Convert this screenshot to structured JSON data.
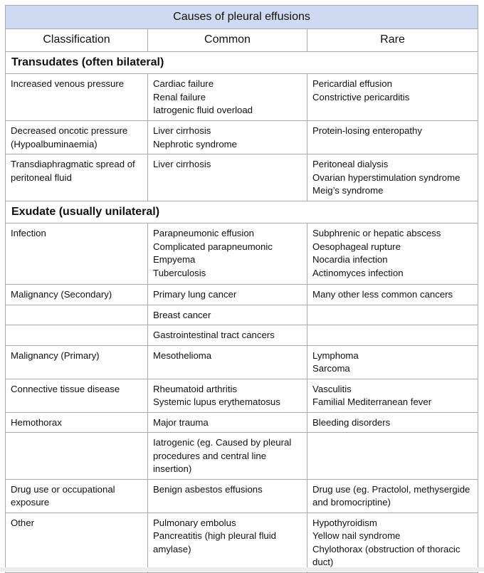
{
  "table": {
    "title": "Causes of pleural effusions",
    "columns": [
      "Classification",
      "Common",
      "Rare"
    ],
    "colors": {
      "title_background": "#cfdaf0",
      "border": "#a9a9a9"
    },
    "sections": [
      {
        "heading": "Transudates (often bilateral)",
        "rows": [
          {
            "classification": "Increased venous pressure",
            "common": [
              "Cardiac failure",
              "Renal failure",
              "Iatrogenic fluid overload"
            ],
            "rare": [
              "Pericardial effusion",
              "Constrictive pericarditis"
            ]
          },
          {
            "classification": "Decreased oncotic pressure (Hypoalbuminaemia)",
            "common": [
              "Liver cirrhosis",
              "Nephrotic syndrome"
            ],
            "rare": [
              "Protein-losing enteropathy"
            ]
          },
          {
            "classification": "Transdiaphragmatic spread of peritoneal fluid",
            "common": [
              "Liver cirrhosis"
            ],
            "rare": [
              "Peritoneal dialysis",
              "Ovarian hyperstimulation syndrome",
              "Meig’s syndrome"
            ]
          }
        ]
      },
      {
        "heading": "Exudate (usually unilateral)",
        "rows": [
          {
            "classification": "Infection",
            "common": [
              "Parapneumonic effusion",
              "Complicated parapneumonic",
              "Empyema",
              "Tuberculosis"
            ],
            "rare": [
              "Subphrenic or hepatic abscess",
              "Oesophageal rupture",
              "Nocardia infection",
              "Actinomyces infection"
            ]
          },
          {
            "classification": "Malignancy (Secondary)",
            "common": [
              "Primary lung cancer"
            ],
            "rare": [
              "Many other less common cancers"
            ]
          },
          {
            "classification": "",
            "common": [
              "Breast cancer"
            ],
            "rare": []
          },
          {
            "classification": "",
            "common": [
              "Gastrointestinal tract cancers"
            ],
            "rare": []
          },
          {
            "classification": "Malignancy (Primary)",
            "common": [
              "Mesothelioma"
            ],
            "rare": [
              "Lymphoma",
              "Sarcoma"
            ]
          },
          {
            "classification": "Connective tissue disease",
            "common": [
              "Rheumatoid arthritis",
              "Systemic lupus erythematosus"
            ],
            "rare": [
              "Vasculitis",
              "Familial Mediterranean fever"
            ]
          },
          {
            "classification": "Hemothorax",
            "common": [
              "Major trauma"
            ],
            "rare": [
              "Bleeding disorders"
            ]
          },
          {
            "classification": "",
            "common": [
              "Iatrogenic (eg. Caused by pleural procedures and central line insertion)"
            ],
            "rare": []
          },
          {
            "classification": "Drug use or occupational exposure",
            "common": [
              "Benign asbestos effusions"
            ],
            "rare": [
              "Drug use (eg. Practolol, methysergide and bromocriptine)"
            ]
          },
          {
            "classification": "Other",
            "common": [
              "Pulmonary embolus",
              "Pancreatitis (high pleural fluid amylase)"
            ],
            "rare": [
              "Hypothyroidism",
              "Yellow nail syndrome",
              "Chylothorax (obstruction of thoracic duct)"
            ]
          }
        ]
      }
    ]
  }
}
